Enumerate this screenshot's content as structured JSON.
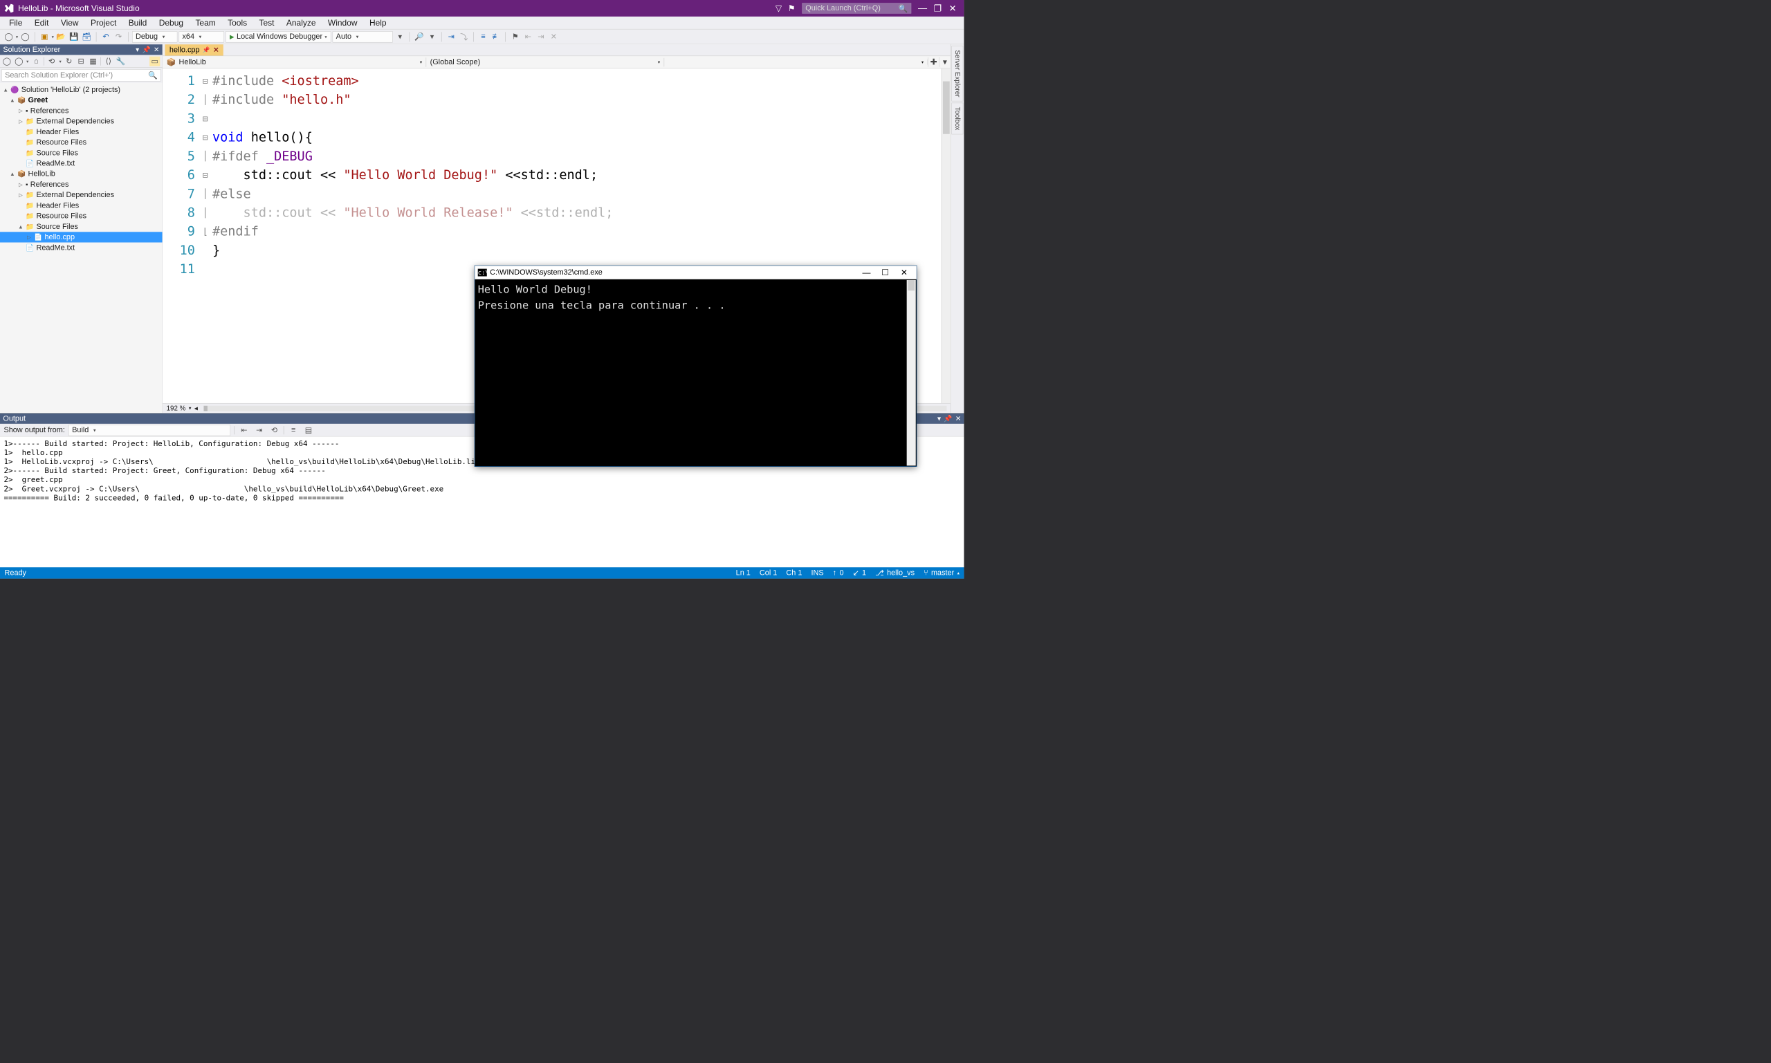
{
  "title_bar": {
    "title": "HelloLib - Microsoft Visual Studio",
    "quicklaunch_placeholder": "Quick Launch (Ctrl+Q)"
  },
  "menu": {
    "items": [
      "File",
      "Edit",
      "View",
      "Project",
      "Build",
      "Debug",
      "Team",
      "Tools",
      "Test",
      "Analyze",
      "Window",
      "Help"
    ]
  },
  "toolbar": {
    "config": "Debug",
    "platform": "x64",
    "debugger": "Local Windows Debugger",
    "threads": "Auto"
  },
  "solution_explorer": {
    "title": "Solution Explorer",
    "search_placeholder": "Search Solution Explorer (Ctrl+')",
    "root": "Solution 'HelloLib' (2 projects)",
    "greet": {
      "name": "Greet",
      "items": [
        "References",
        "External Dependencies",
        "Header Files",
        "Resource Files",
        "Source Files",
        "ReadMe.txt"
      ]
    },
    "hellolib": {
      "name": "HelloLib",
      "refs": "References",
      "ext": "External Dependencies",
      "hdr": "Header Files",
      "res": "Resource Files",
      "src": "Source Files",
      "file": "hello.cpp",
      "readme": "ReadMe.txt"
    }
  },
  "editor": {
    "tab": "hello.cpp",
    "nav_left": "HelloLib",
    "nav_right": "(Global Scope)",
    "zoom": "192 %",
    "lines": {
      "n": [
        "1",
        "2",
        "3",
        "4",
        "5",
        "6",
        "7",
        "8",
        "9",
        "10",
        "11"
      ]
    },
    "code": {
      "l1_a": "#include ",
      "l1_b": "<iostream>",
      "l2_a": "#include ",
      "l2_b": "\"hello.h\"",
      "l4_a": "void",
      "l4_b": " hello(){",
      "l5_a": "#ifdef ",
      "l5_b": "_DEBUG",
      "l6_a": "    std::cout << ",
      "l6_b": "\"Hello World Debug!\"",
      "l6_c": " <<std::endl;",
      "l7": "#else",
      "l8_a": "    std::cout << ",
      "l8_b": "\"Hello World Release!\"",
      "l8_c": " <<std::endl;",
      "l9": "#endif",
      "l10": "}"
    }
  },
  "output": {
    "title": "Output",
    "label": "Show output from:",
    "source": "Build",
    "text": "1>------ Build started: Project: HelloLib, Configuration: Debug x64 ------\n1>  hello.cpp\n1>  HelloLib.vcxproj -> C:\\Users\\                         \\hello_vs\\build\\HelloLib\\x64\\Debug\\HelloLib.lib\n2>------ Build started: Project: Greet, Configuration: Debug x64 ------\n2>  greet.cpp\n2>  Greet.vcxproj -> C:\\Users\\                       \\hello_vs\\build\\HelloLib\\x64\\Debug\\Greet.exe\n========== Build: 2 succeeded, 0 failed, 0 up-to-date, 0 skipped =========="
  },
  "status": {
    "ready": "Ready",
    "ln": "Ln 1",
    "col": "Col 1",
    "ch": "Ch 1",
    "ins": "INS",
    "upcount": "0",
    "dncount": "1",
    "repo": "hello_vs",
    "branch": "master"
  },
  "cmd": {
    "title": "C:\\WINDOWS\\system32\\cmd.exe",
    "body": "Hello World Debug!\nPresione una tecla para continuar . . ."
  },
  "rightdock": {
    "t1": "Server Explorer",
    "t2": "Toolbox"
  }
}
